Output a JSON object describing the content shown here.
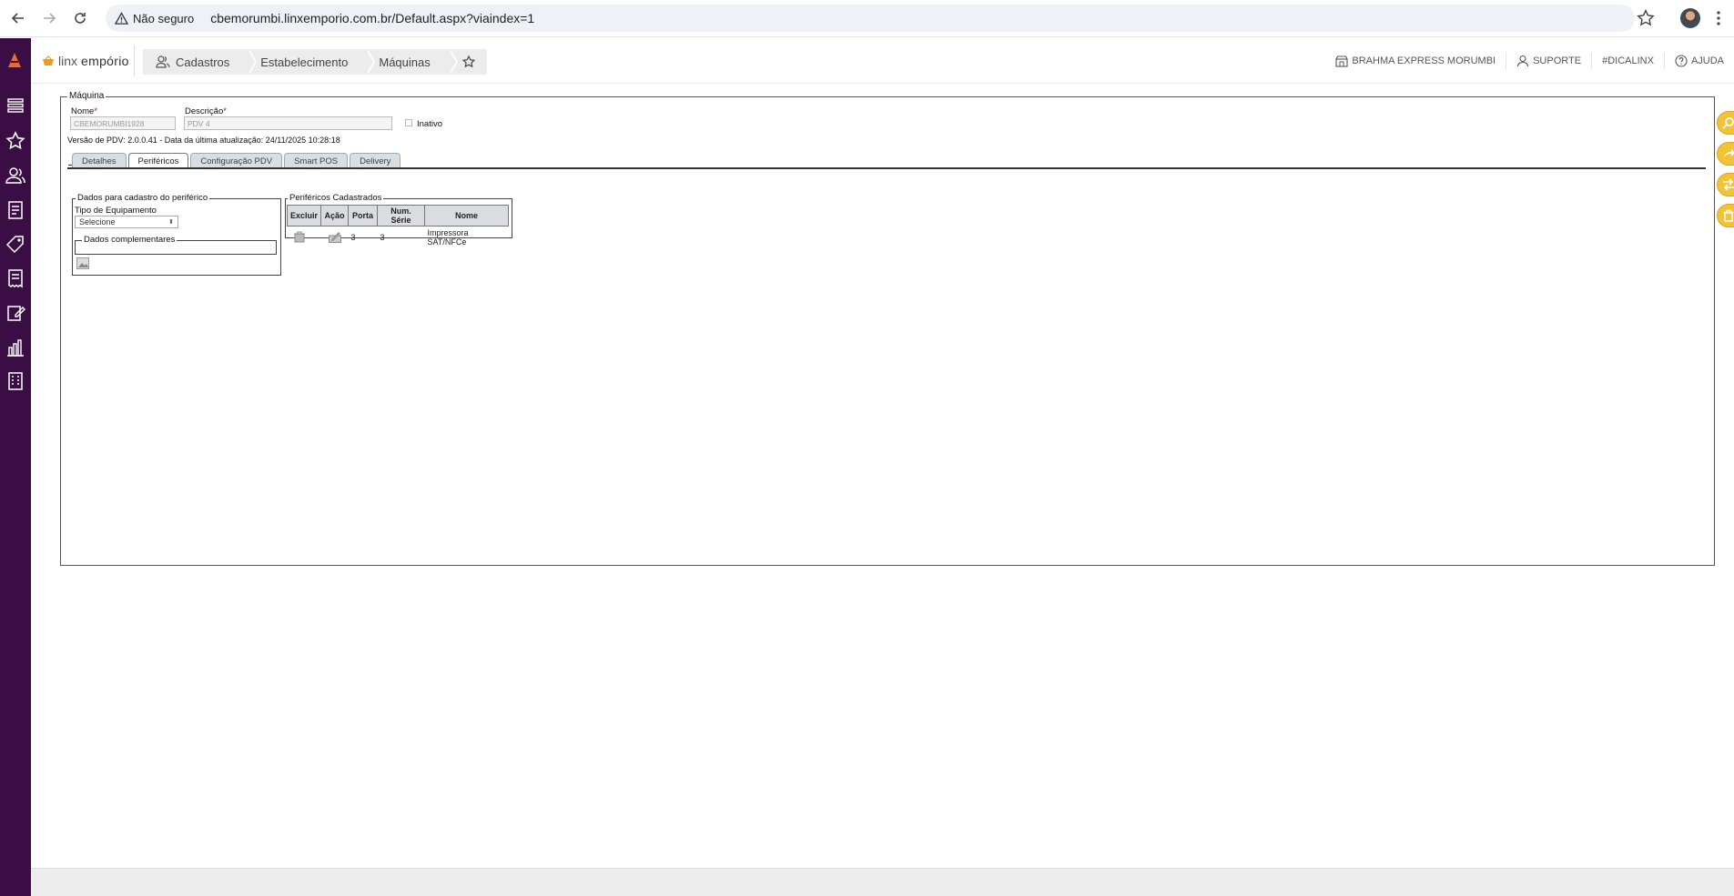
{
  "browser": {
    "security_label": "Não seguro",
    "url": "cbemorumbi.linxemporio.com.br/Default.aspx?viaindex=1"
  },
  "app": {
    "brand_part1": "linx",
    "brand_part2": "empório",
    "breadcrumbs": [
      "Cadastros",
      "Estabelecimento",
      "Máquinas"
    ],
    "header_right": {
      "store": "BRAHMA EXPRESS MORUMBI",
      "support": "SUPORTE",
      "tip": "#DICALINX",
      "help": "AJUDA"
    }
  },
  "form": {
    "section_title": "Máquina",
    "nome_label": "Nome",
    "nome_value": "CBEMORUMBI1928",
    "descricao_label": "Descrição",
    "descricao_value": "PDV 4",
    "required_mark": "*",
    "inativo_label": "Inativo",
    "version_text": "Versão de PDV: 2.0.0.41 - Data da última atualização: 24/11/2025 10:28:18",
    "tabs": [
      "Detalhes",
      "Periféricos",
      "Configuração PDV",
      "Smart POS",
      "Delivery"
    ],
    "active_tab": "Periféricos"
  },
  "peripheral_form": {
    "legend": "Dados para cadastro do periférico",
    "equipment_label": "Tipo de Equipamento",
    "equipment_select": "Selecione",
    "complementary_legend": "Dados complementares"
  },
  "peripherals_table": {
    "legend": "Periféricos Cadastrados",
    "columns": [
      "Excluir",
      "Ação",
      "Porta",
      "Num. Série",
      "Nome"
    ],
    "rows": [
      {
        "porta": "3",
        "num_serie": "3",
        "nome": "Impressora SAT/NFCe"
      }
    ]
  }
}
